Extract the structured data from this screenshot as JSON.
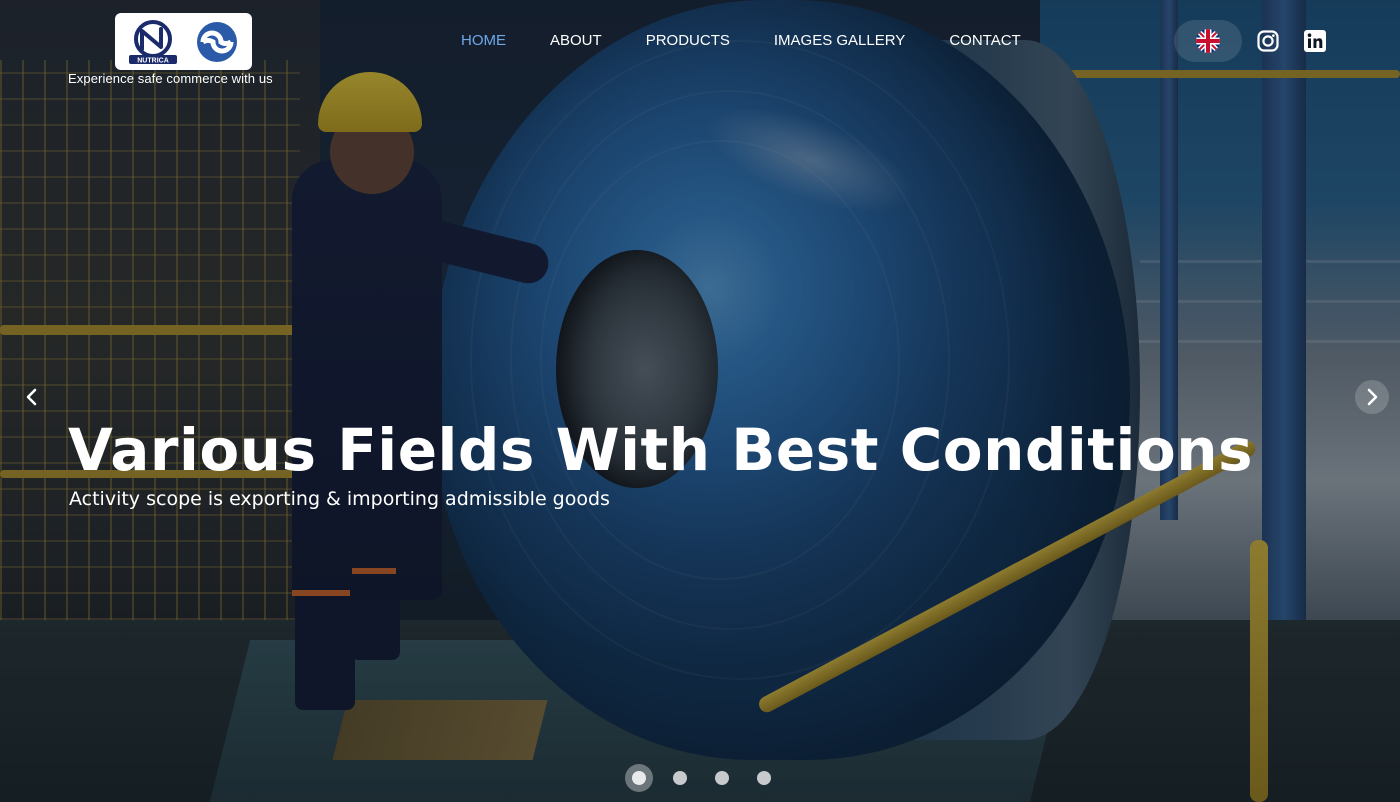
{
  "brand": {
    "logo_text": "NUTRICA",
    "tagline": "Experience safe commerce with us"
  },
  "nav": {
    "items": [
      {
        "label": "HOME",
        "active": true
      },
      {
        "label": "ABOUT",
        "active": false
      },
      {
        "label": "PRODUCTS",
        "active": false
      },
      {
        "label": "IMAGES GALLERY",
        "active": false
      },
      {
        "label": "CONTACT",
        "active": false
      }
    ],
    "active_color": "#6fa8e8"
  },
  "header_icons": {
    "language": "uk-flag-icon",
    "instagram": "instagram-icon",
    "linkedin": "linkedin-icon"
  },
  "hero": {
    "title": "Various Fields With Best Conditions",
    "subtitle": "Activity scope is exporting & importing admissible goods",
    "background": "steel-coil-factory-photo"
  },
  "carousel": {
    "prev_icon": "chevron-left-icon",
    "next_icon": "chevron-right-icon",
    "slide_count": 4,
    "active_slide": 1
  }
}
